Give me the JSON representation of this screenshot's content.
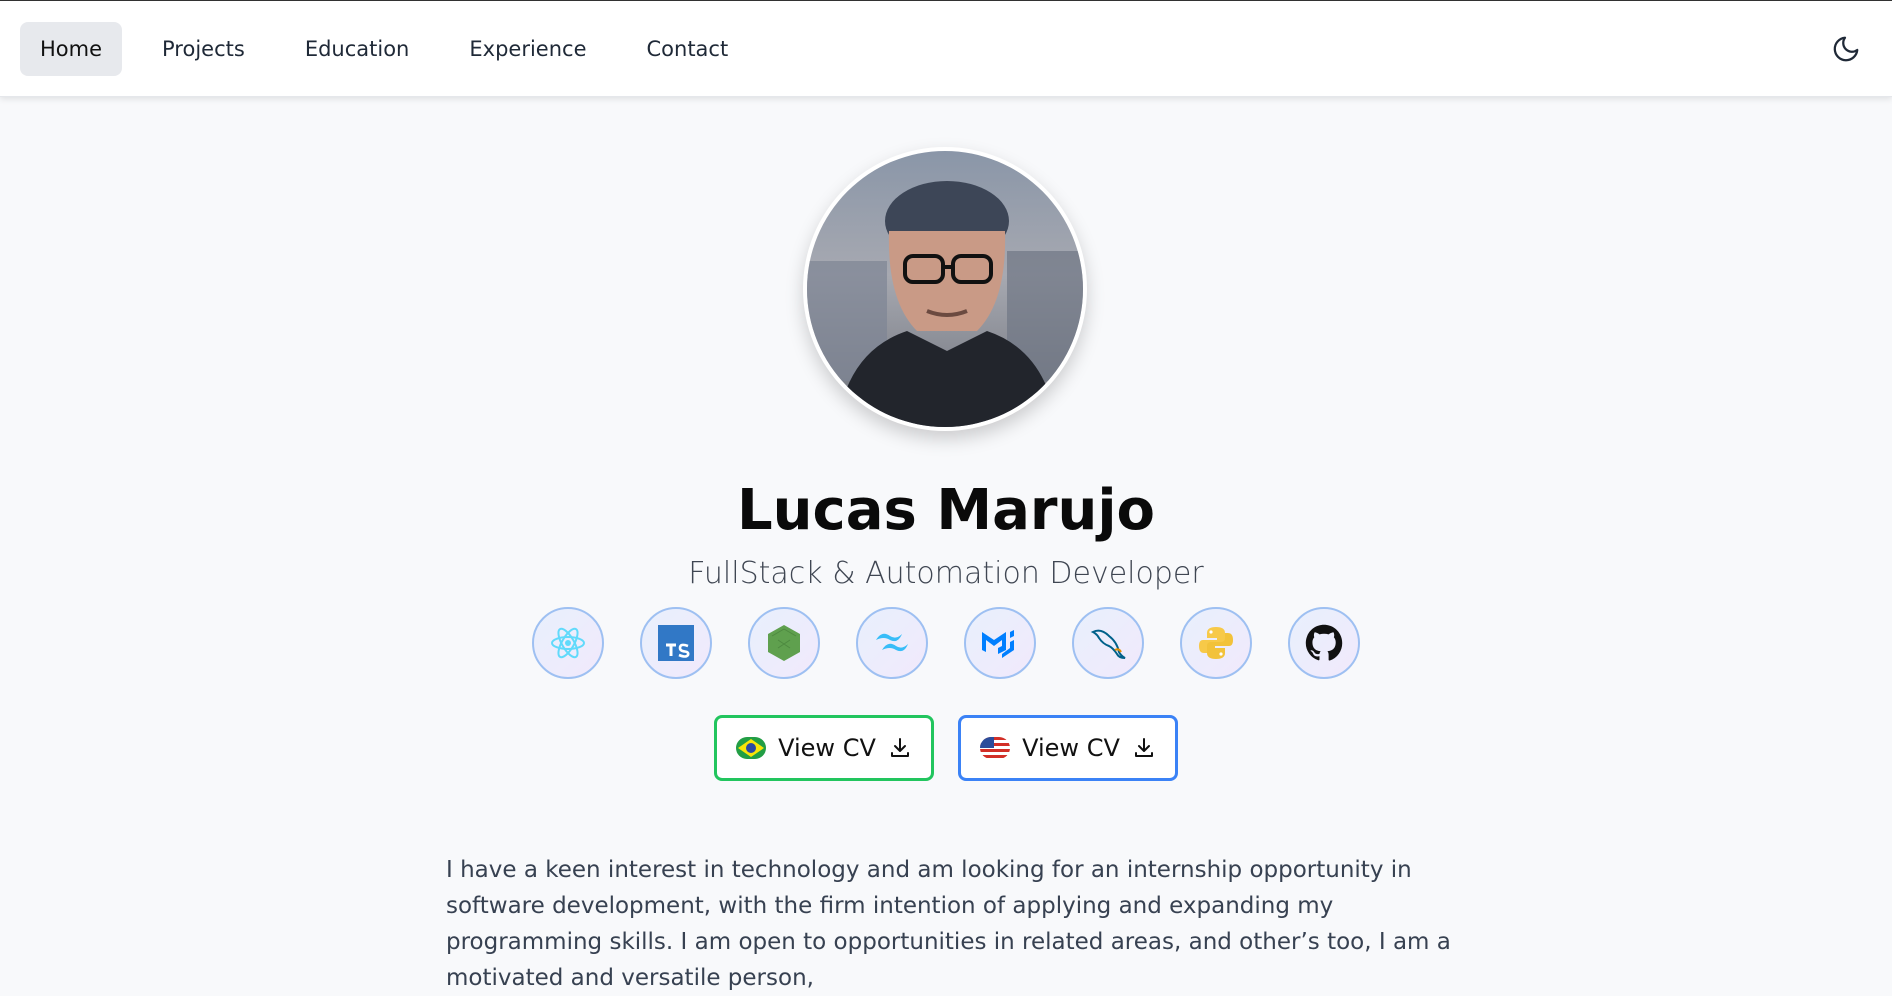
{
  "nav": {
    "items": [
      {
        "label": "Home",
        "active": true
      },
      {
        "label": "Projects",
        "active": false
      },
      {
        "label": "Education",
        "active": false
      },
      {
        "label": "Experience",
        "active": false
      },
      {
        "label": "Contact",
        "active": false
      }
    ],
    "theme_icon": "moon-icon"
  },
  "profile": {
    "name": "Lucas Marujo",
    "subtitle": "FullStack & Automation Developer",
    "avatar_icon": "profile-photo"
  },
  "technologies": [
    {
      "icon": "react-icon",
      "color": "#61dafb"
    },
    {
      "icon": "typescript-icon",
      "color": "#3178c6"
    },
    {
      "icon": "nodejs-icon",
      "color": "#5fa04e"
    },
    {
      "icon": "tailwind-icon",
      "color": "#38bdf8"
    },
    {
      "icon": "material-ui-icon",
      "color": "#007fff"
    },
    {
      "icon": "mysql-icon",
      "color": "#00618a"
    },
    {
      "icon": "python-icon",
      "color": "#f7c948"
    },
    {
      "icon": "github-icon",
      "color": "#111111"
    }
  ],
  "cv_buttons": [
    {
      "label": "View CV",
      "flag": "brazil-flag-icon",
      "accent": "#22c55e"
    },
    {
      "label": "View CV",
      "flag": "usa-flag-icon",
      "accent": "#3b82f6"
    }
  ],
  "about": {
    "text": "I have a keen interest in technology and am looking for an internship opportunity in software development, with the firm intention of applying and expanding my programming skills. I am open to opportunities in related areas, and other’s too, I am a motivated and versatile person,"
  }
}
